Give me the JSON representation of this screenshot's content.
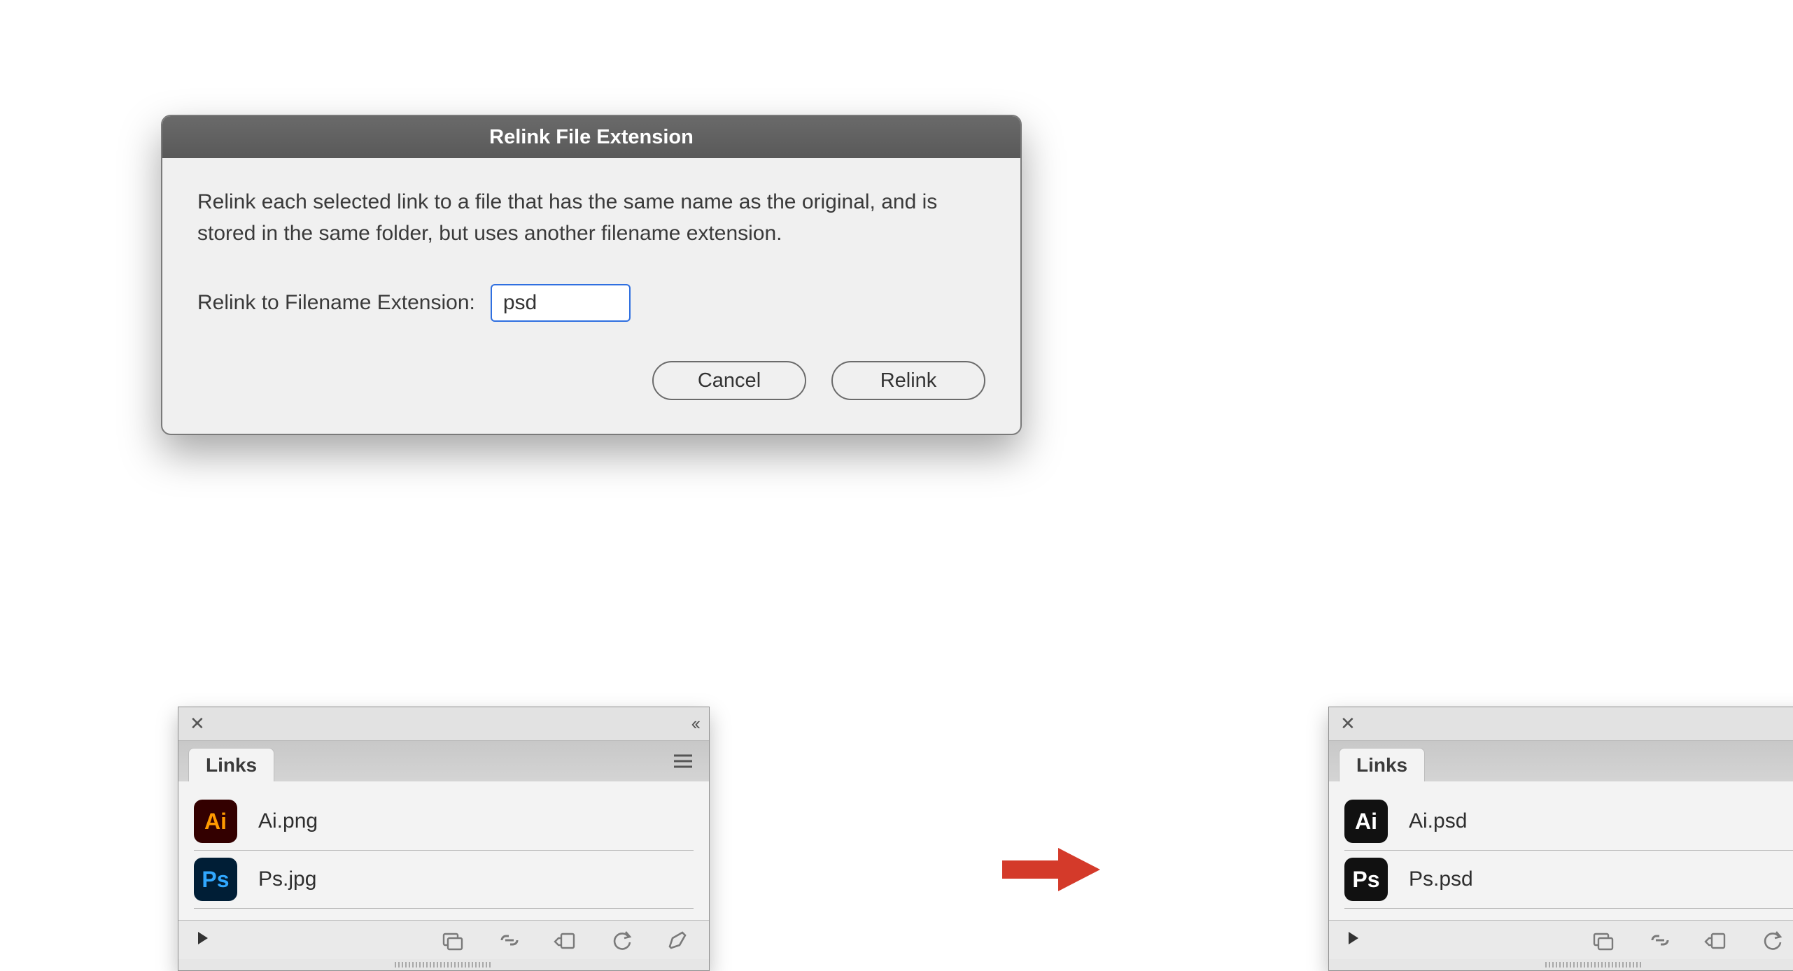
{
  "dialog": {
    "title": "Relink File Extension",
    "description": "Relink each selected link to a file that has the same name as the original, and is stored in the same folder, but uses another filename extension.",
    "ext_label": "Relink to Filename Extension:",
    "ext_value": "psd",
    "cancel": "Cancel",
    "relink": "Relink"
  },
  "panels": {
    "tab_label": "Links",
    "left": {
      "items": [
        {
          "icon": "ai-c",
          "glyph": "Ai",
          "name": "Ai.png"
        },
        {
          "icon": "ps-c",
          "glyph": "Ps",
          "name": "Ps.jpg"
        }
      ]
    },
    "right": {
      "items": [
        {
          "icon": "ai-bw",
          "glyph": "Ai",
          "name": "Ai.psd"
        },
        {
          "icon": "ps-bw",
          "glyph": "Ps",
          "name": "Ps.psd"
        }
      ]
    }
  }
}
